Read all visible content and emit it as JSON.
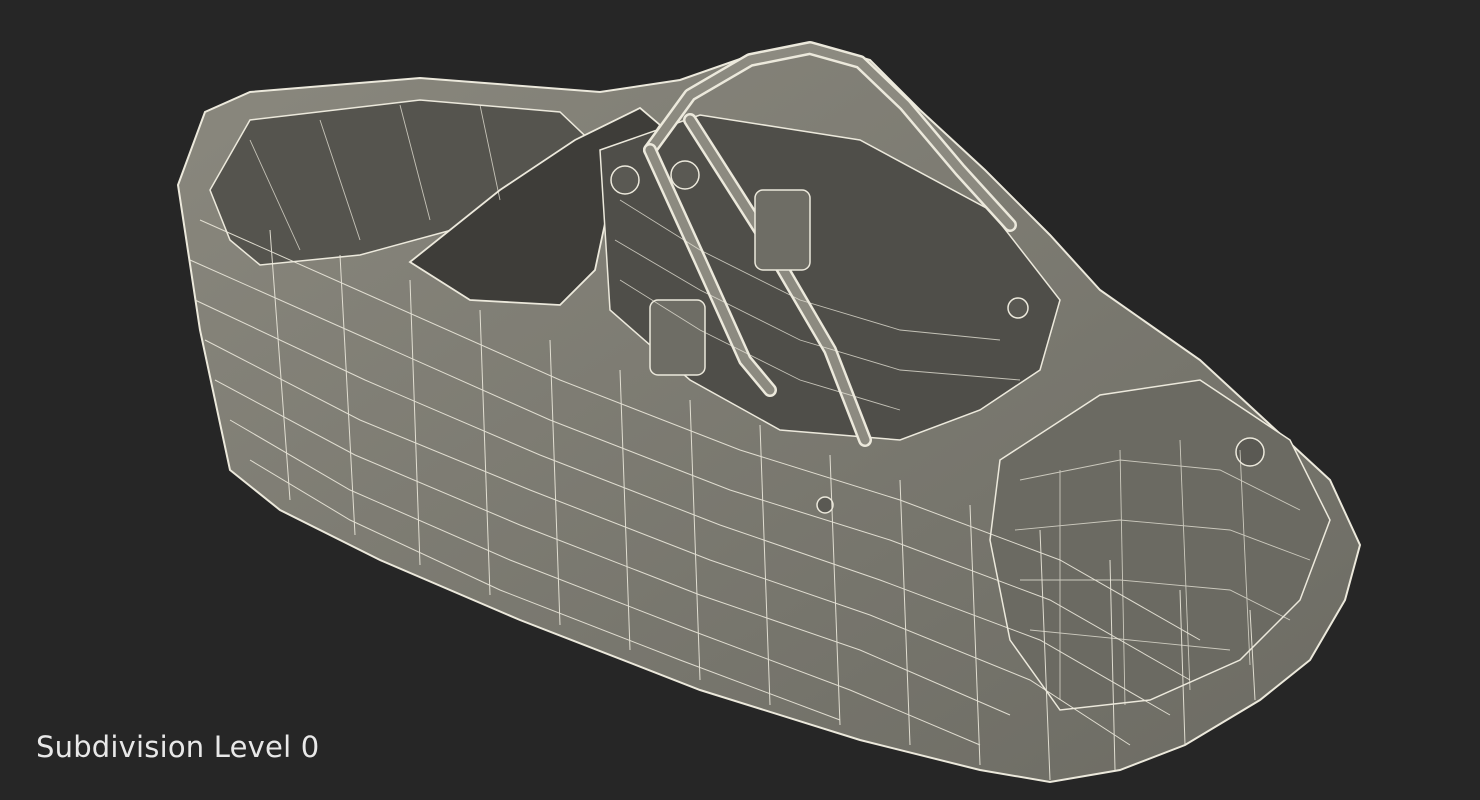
{
  "render": {
    "subject": "speedboat-wireframe",
    "background_color": "#262626",
    "hull_fill_color": "#7d7b72",
    "hull_shade_color": "#5f5e57",
    "interior_fill_color": "#4f4e49",
    "wire_color": "#ece9dc"
  },
  "caption": {
    "text": "Subdivision Level 0"
  }
}
